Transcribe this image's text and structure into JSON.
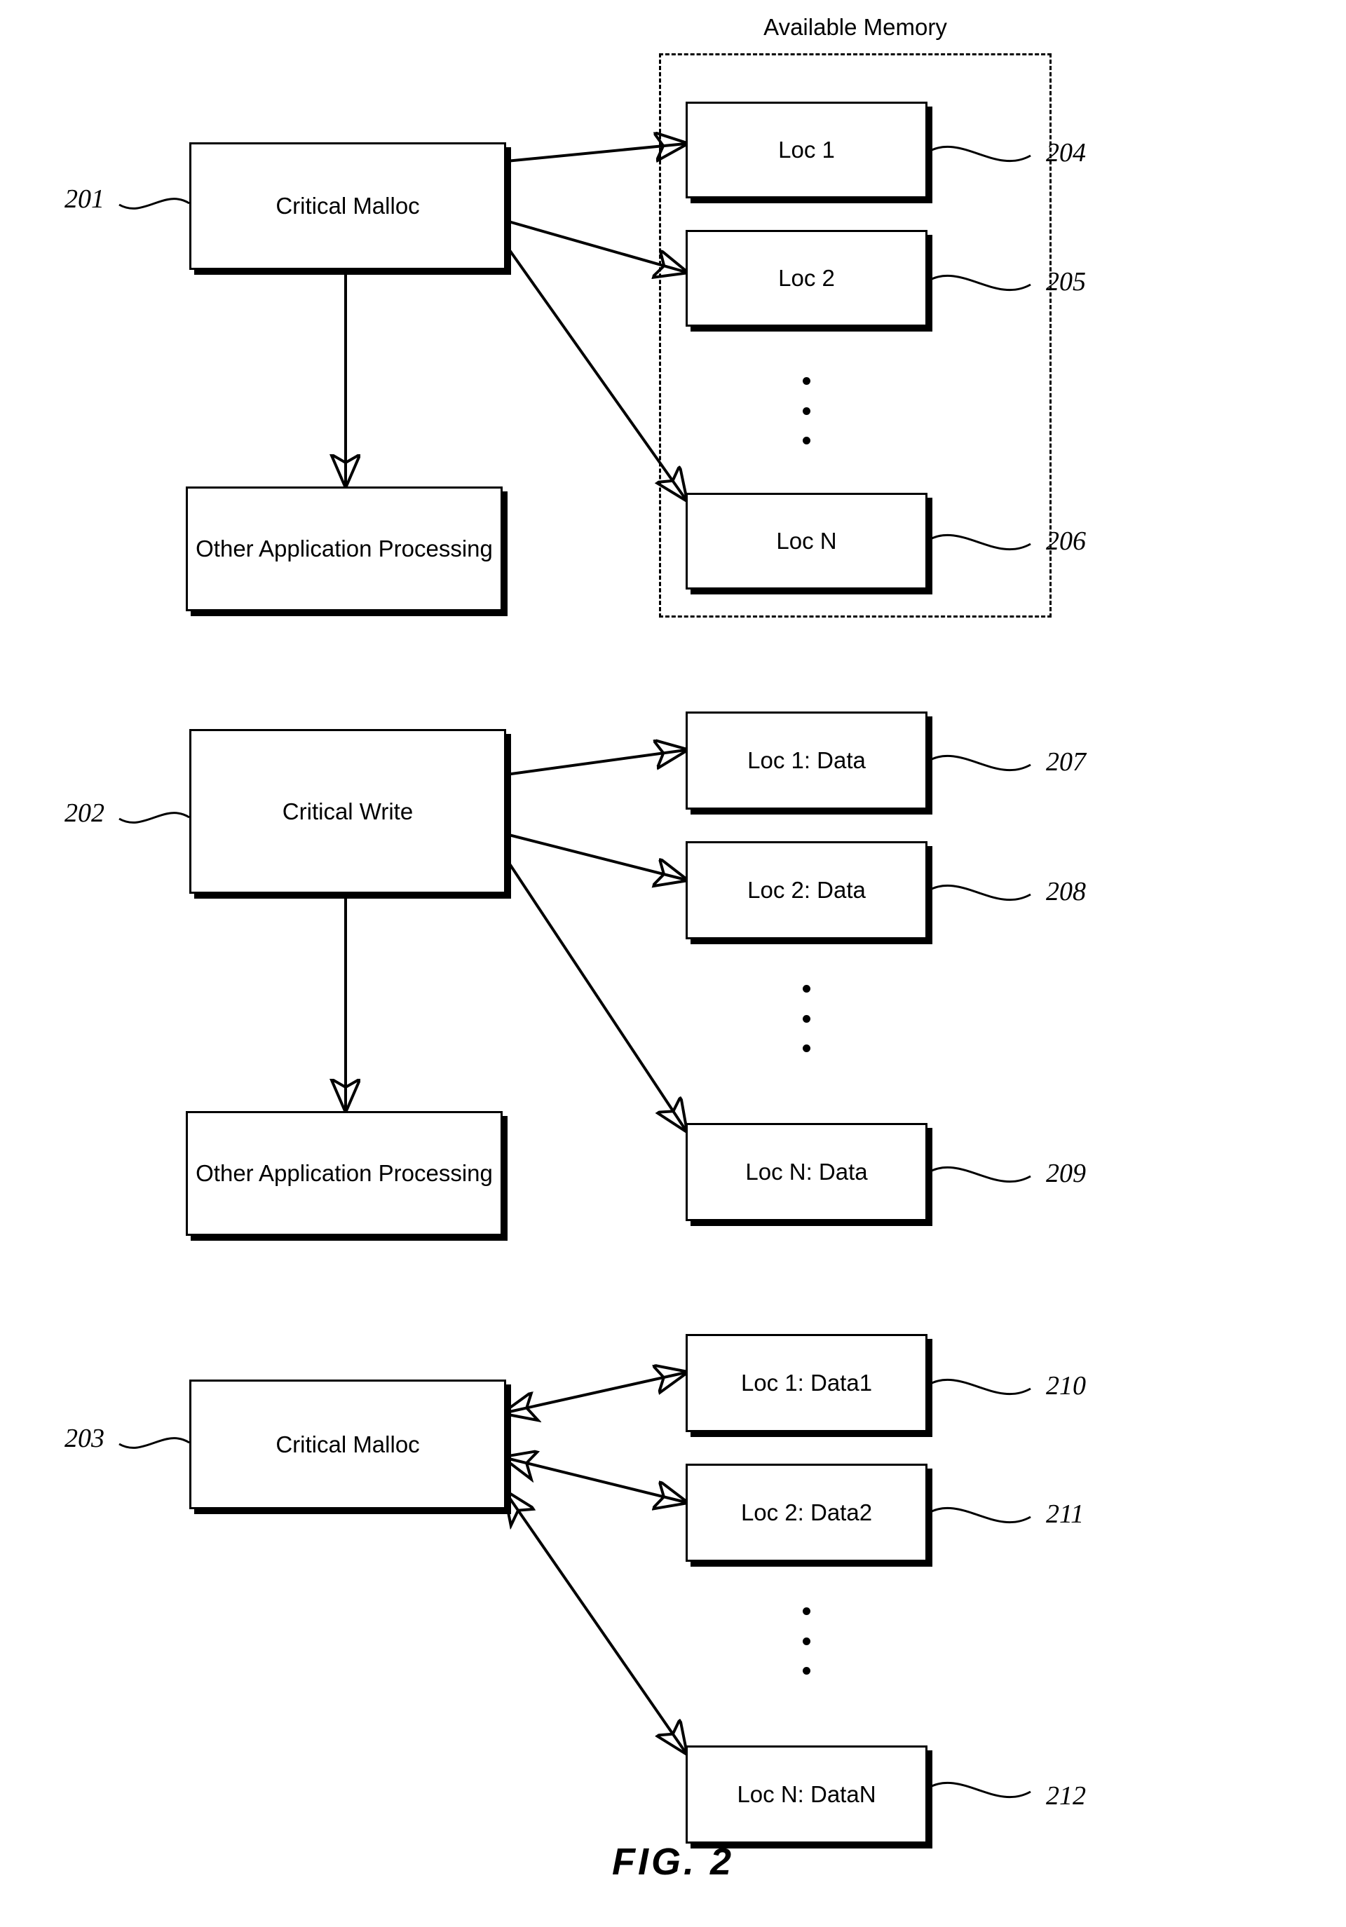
{
  "figure": {
    "caption": "FIG. 2",
    "region_title": "Available Memory"
  },
  "sections": [
    {
      "id": "section-malloc",
      "ref": "201",
      "process_box": "Critical Malloc",
      "other_box": "Other Application Processing",
      "memory_items": [
        {
          "label": "Loc 1",
          "ref": "204"
        },
        {
          "label": "Loc 2",
          "ref": "205"
        },
        {
          "label": "Loc N",
          "ref": "206"
        }
      ]
    },
    {
      "id": "section-write",
      "ref": "202",
      "process_box": "Critical Write",
      "other_box": "Other Application Processing",
      "memory_items": [
        {
          "label": "Loc 1: Data",
          "ref": "207"
        },
        {
          "label": "Loc 2: Data",
          "ref": "208"
        },
        {
          "label": "Loc N: Data",
          "ref": "209"
        }
      ]
    },
    {
      "id": "section-malloc-2",
      "ref": "203",
      "process_box": "Critical Malloc",
      "other_box": null,
      "memory_items": [
        {
          "label": "Loc 1: Data1",
          "ref": "210"
        },
        {
          "label": "Loc 2: Data2",
          "ref": "211"
        },
        {
          "label": "Loc N: DataN",
          "ref": "212"
        }
      ]
    }
  ],
  "colors": {
    "ink": "#000000",
    "paper": "#ffffff"
  }
}
